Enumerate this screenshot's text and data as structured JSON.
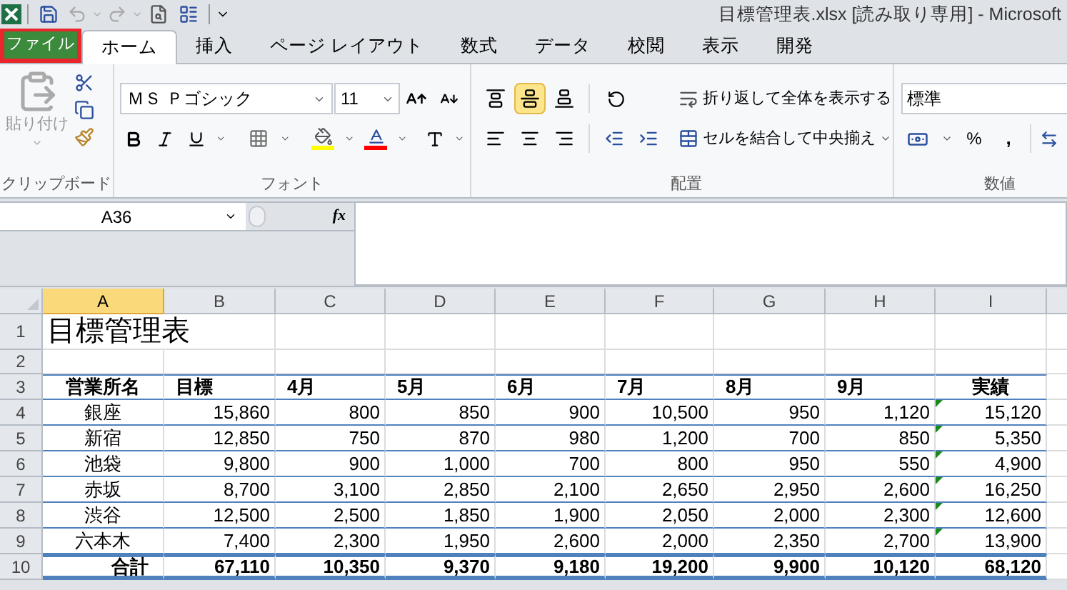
{
  "window": {
    "title": "目標管理表.xlsx  [読み取り専用]  -  Microsoft"
  },
  "tabs": [
    {
      "label": "ファイル",
      "kind": "file",
      "selected": false
    },
    {
      "label": "ホーム",
      "kind": "tab",
      "selected": true
    },
    {
      "label": "挿入",
      "kind": "tab",
      "selected": false
    },
    {
      "label": "ページ レイアウト",
      "kind": "tab",
      "selected": false
    },
    {
      "label": "数式",
      "kind": "tab",
      "selected": false
    },
    {
      "label": "データ",
      "kind": "tab",
      "selected": false
    },
    {
      "label": "校閲",
      "kind": "tab",
      "selected": false
    },
    {
      "label": "表示",
      "kind": "tab",
      "selected": false
    },
    {
      "label": "開発",
      "kind": "tab",
      "selected": false
    }
  ],
  "ribbon": {
    "clipboard": {
      "paste_label": "貼り付け",
      "group_label": "クリップボード"
    },
    "font": {
      "font_name": "ＭＳ Ｐゴシック",
      "font_size": "11",
      "group_label": "フォント"
    },
    "alignment": {
      "vertical": [
        {
          "kind": "top",
          "selected": false
        },
        {
          "kind": "middle",
          "selected": true
        },
        {
          "kind": "bottom",
          "selected": false
        }
      ],
      "horizontal": [
        {
          "kind": "left",
          "selected": false
        },
        {
          "kind": "center",
          "selected": false
        },
        {
          "kind": "right",
          "selected": false
        }
      ],
      "wrap_text": "折り返して全体を表示する",
      "merge_center": "セルを結合して中央揃え",
      "group_label": "配置"
    },
    "number": {
      "format": "標準",
      "percent": "%",
      "comma": ",",
      "group_label": "数値"
    }
  },
  "formula_bar": {
    "name_box": "A36",
    "fx": "fx"
  },
  "columns": [
    {
      "label": "A",
      "selected": true
    },
    {
      "label": "B",
      "selected": false
    },
    {
      "label": "C",
      "selected": false
    },
    {
      "label": "D",
      "selected": false
    },
    {
      "label": "E",
      "selected": false
    },
    {
      "label": "F",
      "selected": false
    },
    {
      "label": "G",
      "selected": false
    },
    {
      "label": "H",
      "selected": false
    },
    {
      "label": "I",
      "selected": false
    }
  ],
  "rows": [
    {
      "number": "1",
      "kind": "title",
      "cells": [
        "目標管理表"
      ]
    },
    {
      "number": "2",
      "kind": "blank",
      "cells": []
    },
    {
      "number": "3",
      "kind": "header",
      "cells": [
        "営業所名",
        "目標",
        "4月",
        "5月",
        "6月",
        "7月",
        "8月",
        "9月",
        "実績"
      ]
    },
    {
      "number": "4",
      "kind": "data",
      "flagged": true,
      "cells": [
        "銀座",
        "15,860",
        "800",
        "850",
        "900",
        "10,500",
        "950",
        "1,120",
        "15,120"
      ]
    },
    {
      "number": "5",
      "kind": "data",
      "flagged": true,
      "cells": [
        "新宿",
        "12,850",
        "750",
        "870",
        "980",
        "1,200",
        "700",
        "850",
        "5,350"
      ]
    },
    {
      "number": "6",
      "kind": "data",
      "flagged": true,
      "cells": [
        "池袋",
        "9,800",
        "900",
        "1,000",
        "700",
        "800",
        "950",
        "550",
        "4,900"
      ]
    },
    {
      "number": "7",
      "kind": "data",
      "flagged": true,
      "cells": [
        "赤坂",
        "8,700",
        "3,100",
        "2,850",
        "2,100",
        "2,650",
        "2,950",
        "2,600",
        "16,250"
      ]
    },
    {
      "number": "8",
      "kind": "data",
      "flagged": true,
      "cells": [
        "渋谷",
        "12,500",
        "2,500",
        "1,850",
        "1,900",
        "2,050",
        "2,000",
        "2,300",
        "12,600"
      ]
    },
    {
      "number": "9",
      "kind": "data",
      "flagged": true,
      "cells": [
        "六本木",
        "7,400",
        "2,300",
        "1,950",
        "2,600",
        "2,000",
        "2,350",
        "2,700",
        "13,900"
      ]
    },
    {
      "number": "10",
      "kind": "total",
      "flagged": false,
      "cells": [
        "合計",
        "67,110",
        "10,350",
        "9,370",
        "9,180",
        "19,200",
        "9,900",
        "10,120",
        "68,120"
      ]
    }
  ]
}
